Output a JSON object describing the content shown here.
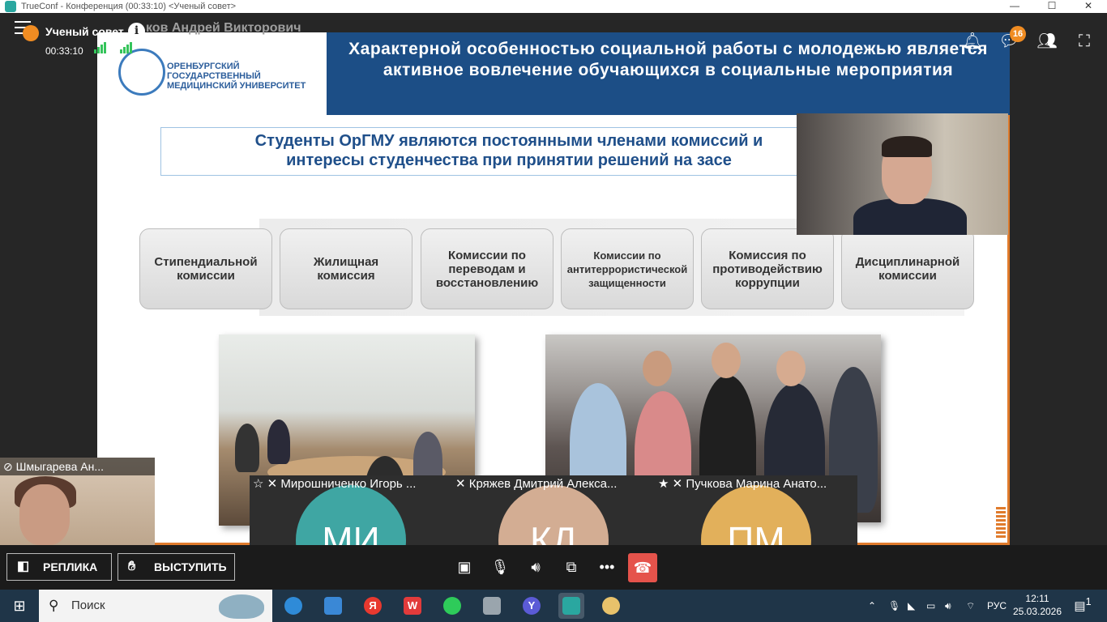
{
  "window": {
    "title": "TrueConf - Конференция (00:33:10) <Ученый совет>",
    "minimize": "—",
    "maximize": "☐",
    "close": "✕"
  },
  "conference": {
    "name": "Ученый совет",
    "timer": "00:33:10",
    "speaker_name_faded": "ков Андрей Викторович",
    "chat_unread": "16"
  },
  "slide": {
    "banner": "Характерной особенностью социальной работы с молодежью является активное вовлечение обучающихся в социальные мероприятия",
    "university": "ОРЕНБУРГСКИЙ ГОСУДАРСТВЕННЫЙ МЕДИЦИНСКИЙ УНИВЕРСИТЕТ",
    "subtitle_line1": "Студенты ОрГМУ являются постоянными членами комиссий и",
    "subtitle_line2": "интересы студенчества при принятии решений на засе",
    "committees": [
      "Стипендиальной комиссии",
      "Жилищная комиссия",
      "Комиссии по переводам и восстановлению",
      "Комиссии по антитеррористической защищенности",
      "Комиссия по противодействию коррупции",
      "Дисциплинарной комиссии"
    ]
  },
  "self": {
    "label": "Шмыгарева Ан..."
  },
  "participants": [
    {
      "label": "Мирошниченко Игорь ...",
      "initials": "МИ",
      "color": "#3fa6a3"
    },
    {
      "label": "Кряжев Дмитрий Алекса...",
      "initials": "КД",
      "color": "#d3ad93"
    },
    {
      "label": "Пучкова Марина Анато...",
      "initials": "ПМ",
      "color": "#e2b05b"
    }
  ],
  "controls": {
    "replica": "РЕПЛИКА",
    "speak": "ВЫСТУПИТЬ"
  },
  "taskbar": {
    "search_placeholder": "Поиск",
    "lang": "РУС",
    "time": "12:11",
    "date": "25.03.2026",
    "notifications": "1"
  }
}
